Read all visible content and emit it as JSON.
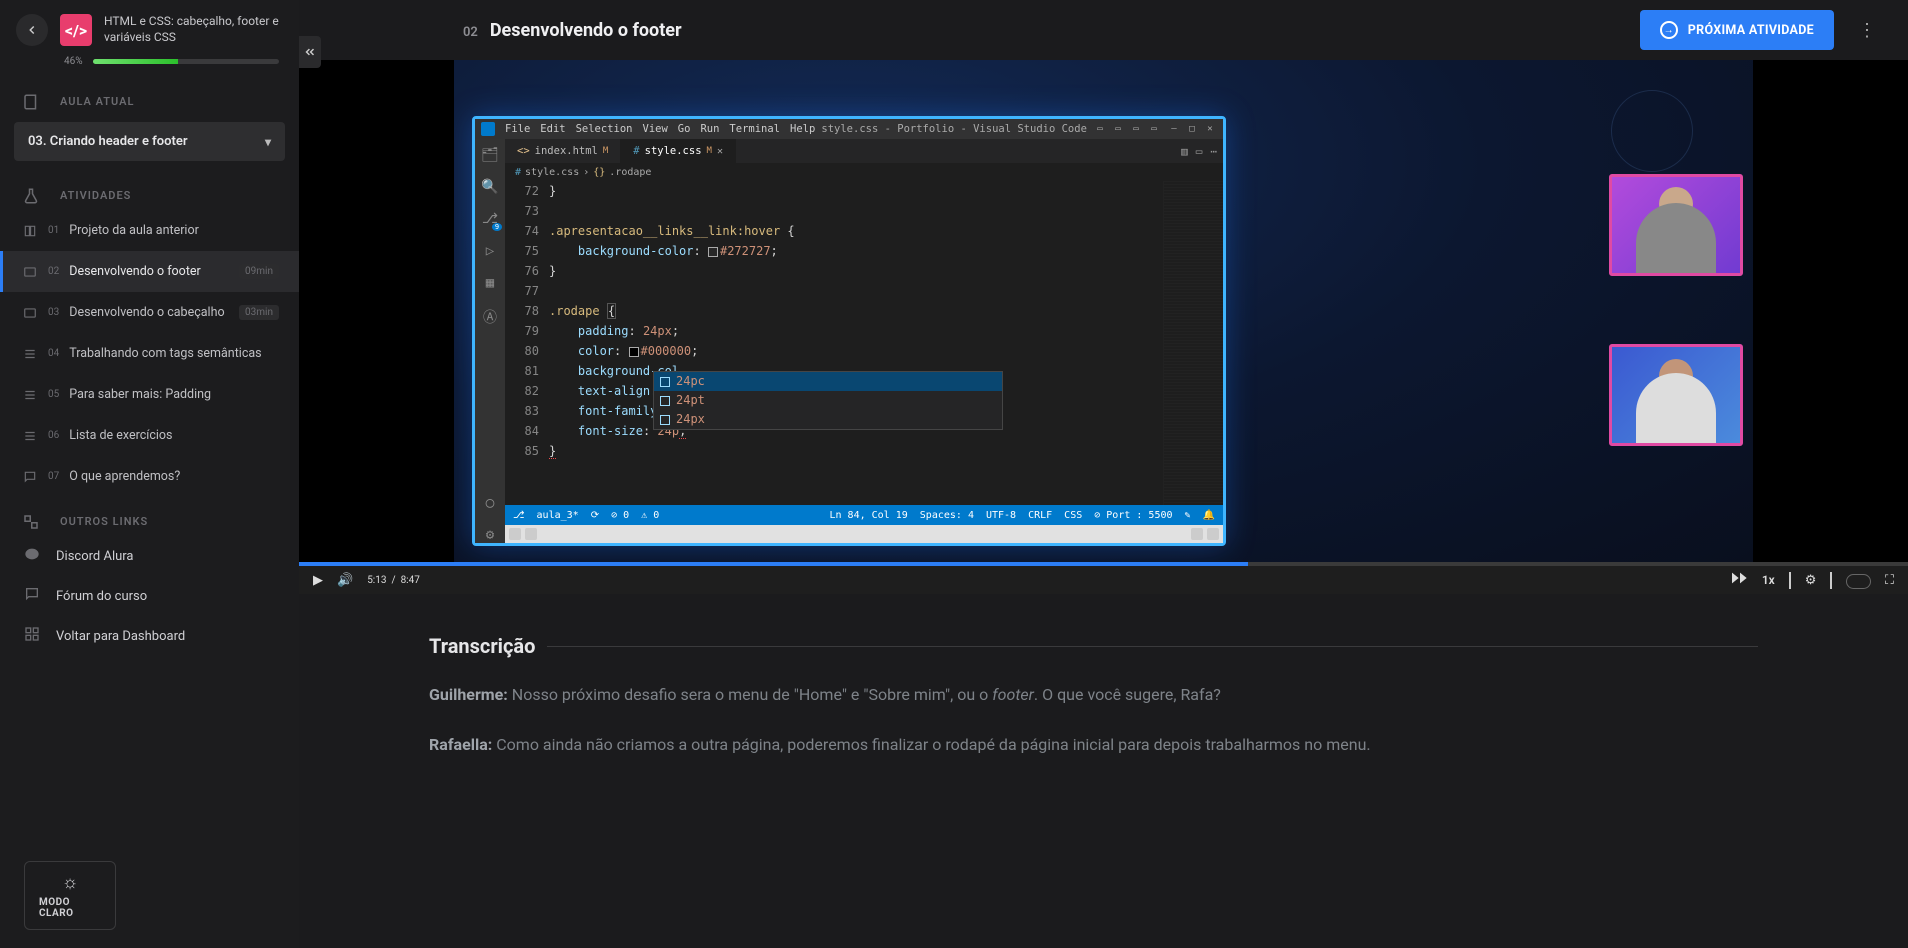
{
  "course": {
    "title": "HTML e CSS: cabeçalho, footer e variáveis CSS",
    "progress_pct": "46%",
    "progress_fill": 46
  },
  "sections": {
    "aula_atual_label": "AULA ATUAL",
    "lesson_select": "03. Criando header e footer",
    "atividades_label": "ATIVIDADES",
    "outros_links_label": "OUTROS LINKS"
  },
  "activities": [
    {
      "num": "01",
      "name": "Projeto da aula anterior",
      "icon": "book",
      "dur": ""
    },
    {
      "num": "02",
      "name": "Desenvolvendo o footer",
      "icon": "video",
      "dur": "09min",
      "active": true
    },
    {
      "num": "03",
      "name": "Desenvolvendo o cabeçalho",
      "icon": "video",
      "dur": "03min"
    },
    {
      "num": "04",
      "name": "Trabalhando com tags semânticas",
      "icon": "list",
      "dur": ""
    },
    {
      "num": "05",
      "name": "Para saber mais: Padding",
      "icon": "list",
      "dur": ""
    },
    {
      "num": "06",
      "name": "Lista de exercícios",
      "icon": "list",
      "dur": ""
    },
    {
      "num": "07",
      "name": "O que aprendemos?",
      "icon": "chat",
      "dur": ""
    }
  ],
  "links": [
    {
      "name": "Discord Alura",
      "icon": "discord"
    },
    {
      "name": "Fórum do curso",
      "icon": "forum"
    },
    {
      "name": "Voltar para Dashboard",
      "icon": "dashboard"
    }
  ],
  "theme_btn": "MODO CLARO",
  "topbar": {
    "step_num": "02",
    "step_title": "Desenvolvendo o footer",
    "next_label": "PRÓXIMA ATIVIDADE"
  },
  "player": {
    "current": "5:13",
    "sep": "/",
    "total": "8:47",
    "speed": "1x"
  },
  "vscode": {
    "menu": [
      "File",
      "Edit",
      "Selection",
      "View",
      "Go",
      "Run",
      "Terminal",
      "Help"
    ],
    "title": "style.css - Portfolio - Visual Studio Code",
    "tabs": [
      {
        "label": "index.html",
        "mod": "M"
      },
      {
        "label": "style.css",
        "mod": "M",
        "active": true
      }
    ],
    "breadcrumb_file": "style.css",
    "breadcrumb_sel": ".rodape",
    "lines_start": 72,
    "gutter": [
      "72",
      "73",
      "74",
      "75",
      "76",
      "77",
      "78",
      "79",
      "80",
      "81",
      "82",
      "83",
      "84",
      "85"
    ],
    "intellisense": [
      "24pc",
      "24pt",
      "24px"
    ],
    "status": {
      "branch": "aula_3*",
      "errors": "0",
      "warnings": "0",
      "ln_col": "Ln 84, Col 19",
      "spaces": "Spaces: 4",
      "enc": "UTF-8",
      "eol": "CRLF",
      "lang": "CSS",
      "port": "Port : 5500"
    }
  },
  "transcript": {
    "title": "Transcrição",
    "p1_speaker": "Guilherme:",
    "p1_text_a": " Nosso próximo desafio sera o menu de \"Home\" e \"Sobre mim\", ou o ",
    "p1_em": "footer",
    "p1_text_b": ". O que você sugere, Rafa?",
    "p2_speaker": "Rafaella:",
    "p2_text": " Como ainda não criamos a outra página, poderemos finalizar o rodapé da página inicial para depois trabalharmos no menu."
  }
}
